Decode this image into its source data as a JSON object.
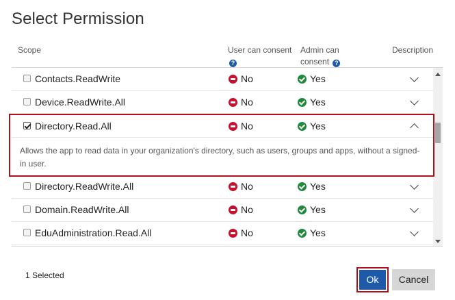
{
  "dialog": {
    "title": "Select Permission"
  },
  "columns": {
    "scope": "Scope",
    "user_consent": "User can consent",
    "admin_consent_line1": "Admin can",
    "admin_consent_line2": "consent",
    "description": "Description",
    "help_glyph": "?"
  },
  "rows": [
    {
      "scope": "Contacts.ReadWrite",
      "user": "No",
      "admin": "Yes",
      "checked": false
    },
    {
      "scope": "Device.ReadWrite.All",
      "user": "No",
      "admin": "Yes",
      "checked": false
    },
    {
      "scope": "Directory.Read.All",
      "user": "No",
      "admin": "Yes",
      "checked": true,
      "expanded": true,
      "description": "Allows the app to read data in your organization's directory, such as users, groups and apps, without a signed-in user."
    },
    {
      "scope": "Directory.ReadWrite.All",
      "user": "No",
      "admin": "Yes",
      "checked": false
    },
    {
      "scope": "Domain.ReadWrite.All",
      "user": "No",
      "admin": "Yes",
      "checked": false
    },
    {
      "scope": "EduAdministration.Read.All",
      "user": "No",
      "admin": "Yes",
      "checked": false
    }
  ],
  "footer": {
    "selected_count": "1 Selected",
    "ok_label": "Ok",
    "cancel_label": "Cancel"
  },
  "colors": {
    "accent": "#1e5aa8",
    "highlight_border": "#b0101a",
    "no": "#c8102e",
    "yes": "#1e8a3a"
  },
  "icons": {
    "no": "no-entry-icon",
    "yes": "check-circle-icon",
    "help": "help-icon",
    "expand": "chevron-down-icon",
    "collapse": "chevron-up-icon"
  }
}
